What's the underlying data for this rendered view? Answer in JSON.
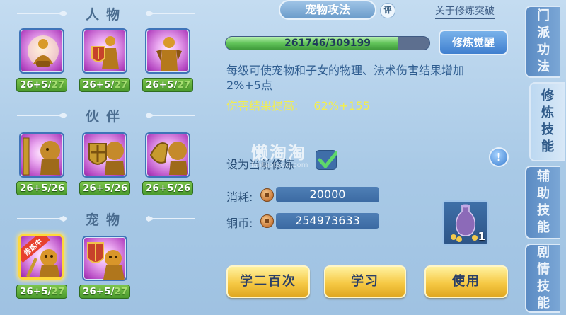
{
  "sections": {
    "people": "人物",
    "partners": "伙伴",
    "pets": "宠物"
  },
  "skills": {
    "people": [
      {
        "level": "26+5/",
        "cap": "27"
      },
      {
        "level": "26+5/",
        "cap": "27"
      },
      {
        "level": "26+5/",
        "cap": "27"
      }
    ],
    "partners": [
      {
        "level": "26+5/26",
        "cap": ""
      },
      {
        "level": "26+5/26",
        "cap": ""
      },
      {
        "level": "26+5/26",
        "cap": ""
      }
    ],
    "pets": [
      {
        "level": "26+5/",
        "cap": "27",
        "tag": "修炼中"
      },
      {
        "level": "26+5/",
        "cap": "27"
      }
    ]
  },
  "detail": {
    "title": "宠物攻法",
    "eval_badge": "评",
    "about_link": "关于修炼突破",
    "progress_text": "261746/309199",
    "progress_fraction": 0.8465,
    "awaken_button": "修炼觉醒",
    "description": "每级可使宠物和子女的物理、法术伤害结果增加2%+5点",
    "damage_label": "伤害结果提高:",
    "damage_value": "62%+155",
    "set_current_label": "设为当前修炼",
    "set_current_checked": true,
    "hint_icon": "!",
    "cost_label": "消耗:",
    "cost_value": "20000",
    "coins_label": "铜币:",
    "coins_value": "254973633",
    "item_count": "1"
  },
  "buttons": {
    "learn_200": "学二百次",
    "learn": "学习",
    "use": "使用"
  },
  "tabs": [
    {
      "label": [
        "门",
        "派",
        "功",
        "法"
      ],
      "active": false
    },
    {
      "label": [
        "修",
        "炼",
        "技",
        "能"
      ],
      "active": true
    },
    {
      "label": [
        "辅",
        "助",
        "技",
        "能"
      ],
      "active": false
    },
    {
      "label": [
        "剧",
        "情",
        "技",
        "能"
      ],
      "active": false
    }
  ],
  "watermark": {
    "main": "懒淘淘",
    "sub": "lantaotaoxi.com"
  },
  "colors": {
    "accent_yellow": "#f3ee4e",
    "level_green": "#4a9a2d",
    "selected_border": "#ffd83a"
  }
}
